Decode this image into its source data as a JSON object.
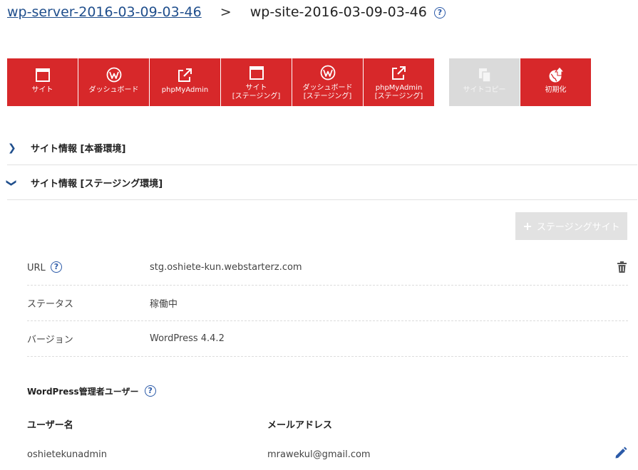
{
  "breadcrumb": {
    "server": "wp-server-2016-03-09-03-46",
    "separator": ">",
    "site": "wp-site-2016-03-09-03-46",
    "help": "?"
  },
  "toolbar": {
    "buttons": [
      {
        "label": "サイト",
        "icon": "browser-window-icon"
      },
      {
        "label": "ダッシュボード",
        "icon": "wordpress-icon"
      },
      {
        "label": "phpMyAdmin",
        "icon": "external-link-icon"
      },
      {
        "label": "サイト\n[ステージング]",
        "icon": "browser-window-icon"
      },
      {
        "label": "ダッシュボード\n[ステージング]",
        "icon": "wordpress-icon"
      },
      {
        "label": "phpMyAdmin\n[ステージング]",
        "icon": "external-link-icon"
      },
      {
        "label": "サイトコピー",
        "icon": "copy-icon",
        "disabled": true
      },
      {
        "label": "初期化",
        "icon": "globe-upload-icon"
      }
    ]
  },
  "sections": {
    "production": {
      "title": "サイト情報 [本番環境]",
      "chevron": "❯"
    },
    "staging": {
      "title": "サイト情報 [ステージング環境]",
      "chevron": "❯"
    }
  },
  "staging": {
    "add_button": {
      "plus": "+",
      "label": "ステージングサイト"
    },
    "rows": {
      "url": {
        "key": "URL",
        "value": "stg.oshiete-kun.webstarterz.com"
      },
      "status": {
        "key": "ステータス",
        "value": "稼働中"
      },
      "version": {
        "key": "バージョン",
        "value": "WordPress 4.4.2"
      }
    },
    "admin": {
      "heading": "WordPress管理者ユーザー",
      "columns": {
        "username": "ユーザー名",
        "email": "メールアドレス"
      },
      "user": {
        "username": "oshietekunadmin",
        "email": "mrawekul@gmail.com"
      }
    }
  },
  "colors": {
    "accent_red": "#d7282a",
    "link_blue": "#1f4e8c",
    "disabled_gray": "#dadada"
  }
}
